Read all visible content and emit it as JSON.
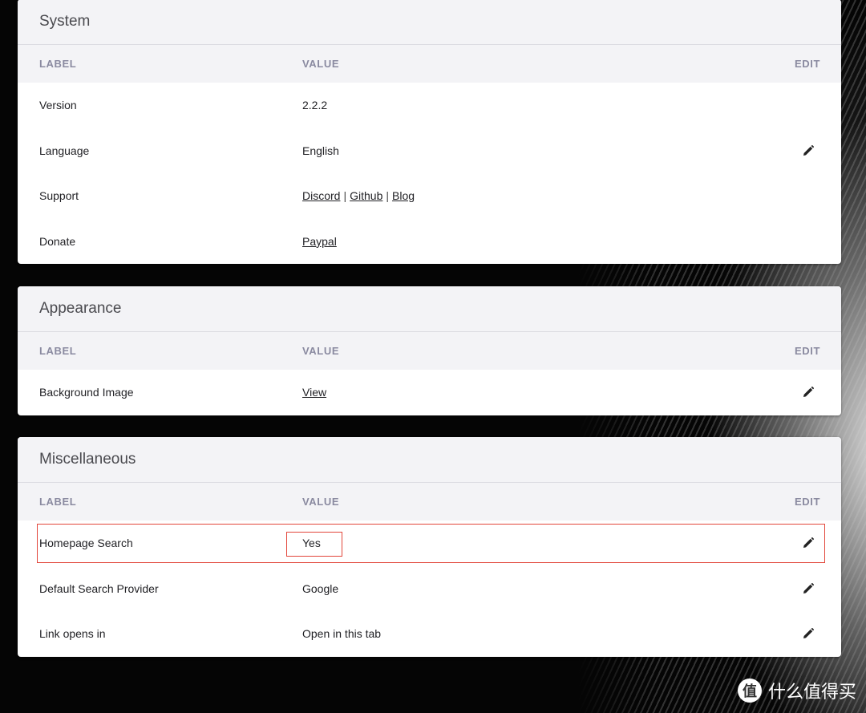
{
  "header_labels": {
    "label": "LABEL",
    "value": "VALUE",
    "edit": "EDIT"
  },
  "system": {
    "title": "System",
    "version": {
      "label": "Version",
      "value": "2.2.2"
    },
    "language": {
      "label": "Language",
      "value": "English"
    },
    "support": {
      "label": "Support",
      "links": [
        "Discord",
        "Github",
        "Blog"
      ],
      "separator": "|"
    },
    "donate": {
      "label": "Donate",
      "link": "Paypal"
    }
  },
  "appearance": {
    "title": "Appearance",
    "background_image": {
      "label": "Background Image",
      "link": "View"
    }
  },
  "misc": {
    "title": "Miscellaneous",
    "homepage_search": {
      "label": "Homepage Search",
      "value": "Yes"
    },
    "default_search_provider": {
      "label": "Default Search Provider",
      "value": "Google"
    },
    "link_opens_in": {
      "label": "Link opens in",
      "value": "Open in this tab"
    }
  },
  "watermark": {
    "glyph": "值",
    "text": "什么值得买"
  },
  "colors": {
    "highlight": "#e2463a",
    "header_bg": "#f3f3f6",
    "header_text": "#8a8aa0"
  },
  "icons": {
    "edit": "pencil-icon"
  }
}
